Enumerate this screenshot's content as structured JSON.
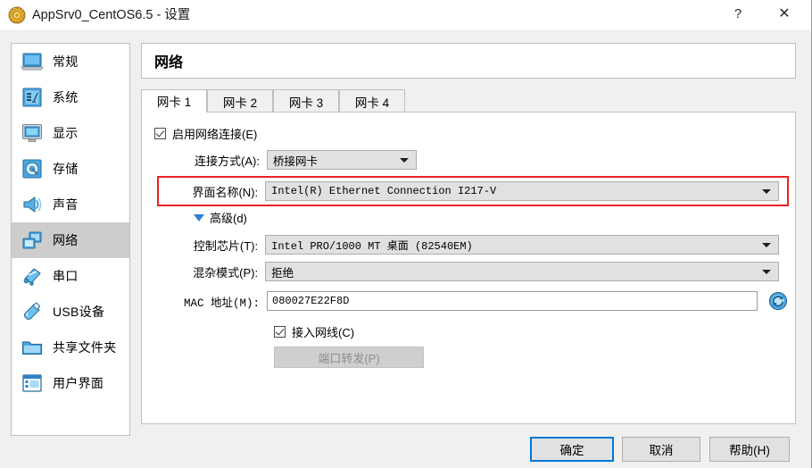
{
  "window": {
    "title": "AppSrv0_CentOS6.5 - 设置",
    "icon": "gear-icon",
    "help_button": "?",
    "close_button": "✕"
  },
  "sidebar": {
    "items": [
      {
        "label": "常规",
        "icon": "monitor-laptop-icon",
        "selected": false
      },
      {
        "label": "系统",
        "icon": "system-chip-icon",
        "selected": false
      },
      {
        "label": "显示",
        "icon": "display-monitor-icon",
        "selected": false
      },
      {
        "label": "存储",
        "icon": "hard-disk-icon",
        "selected": false
      },
      {
        "label": "声音",
        "icon": "speaker-icon",
        "selected": false
      },
      {
        "label": "网络",
        "icon": "network-icon",
        "selected": true
      },
      {
        "label": "串口",
        "icon": "serial-port-icon",
        "selected": false
      },
      {
        "label": "USB设备",
        "icon": "usb-icon",
        "selected": false
      },
      {
        "label": "共享文件夹",
        "icon": "folder-icon",
        "selected": false
      },
      {
        "label": "用户界面",
        "icon": "user-interface-icon",
        "selected": false
      }
    ]
  },
  "page": {
    "header": "网络",
    "tabs": [
      {
        "label": "网卡 1",
        "active": true
      },
      {
        "label": "网卡 2",
        "active": false
      },
      {
        "label": "网卡 3",
        "active": false
      },
      {
        "label": "网卡 4",
        "active": false
      }
    ]
  },
  "form": {
    "enable_network": {
      "label": "启用网络连接(E)",
      "checked": true
    },
    "attached_to": {
      "label": "连接方式(A):",
      "value": "桥接网卡"
    },
    "interface_name": {
      "label": "界面名称(N):",
      "value": "Intel(R) Ethernet Connection I217-V"
    },
    "advanced": {
      "label": "高级(d)",
      "expanded": true
    },
    "adapter_type": {
      "label": "控制芯片(T):",
      "value": "Intel PRO/1000 MT 桌面 (82540EM)"
    },
    "promiscuous": {
      "label": "混杂模式(P):",
      "value": "拒绝"
    },
    "mac_address": {
      "label": "MAC 地址(M):",
      "value": "080027E22F8D",
      "refresh_icon": "refresh-icon"
    },
    "cable_connected": {
      "label": "接入网线(C)",
      "checked": true
    },
    "port_forwarding": {
      "label": "端口转发(P)",
      "enabled": false
    }
  },
  "footer": {
    "ok": "确定",
    "cancel": "取消",
    "help": "帮助(H)"
  },
  "colors": {
    "highlight_box": "#ee2222",
    "selected_row": "#cdcdcd",
    "default_button_border": "#0078d7",
    "expander_triangle": "#2f7fd4"
  }
}
